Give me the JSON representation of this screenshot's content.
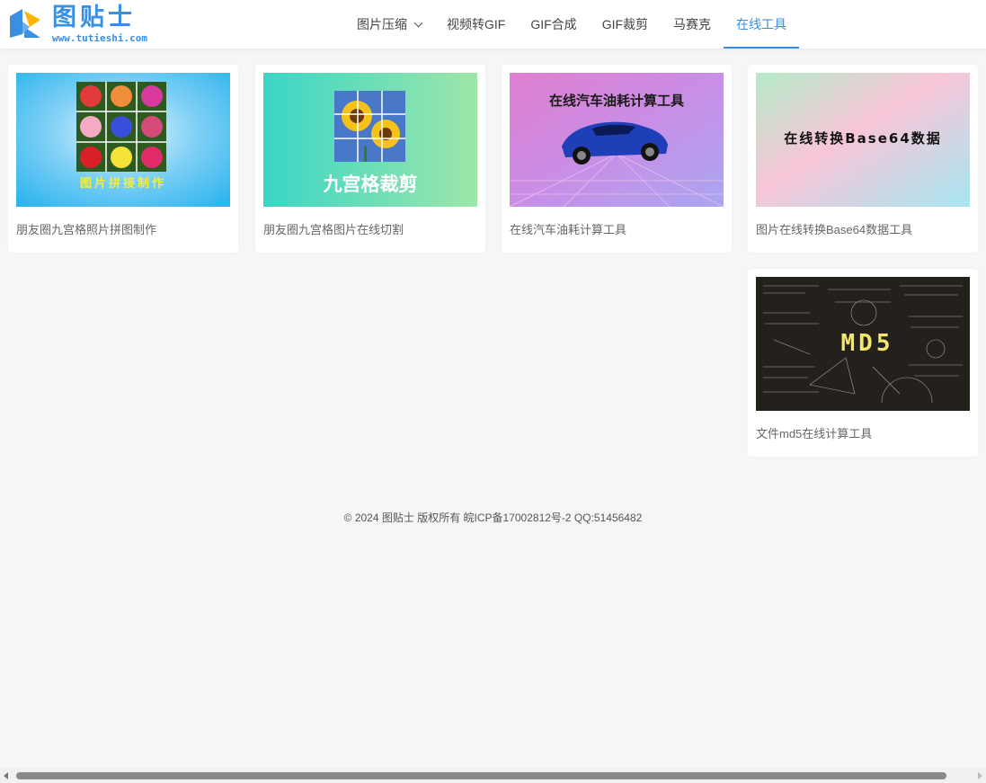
{
  "brand": {
    "name": "图贴士",
    "url_text": "www.tutieshi.com",
    "color": "#3a8fe0"
  },
  "nav": {
    "items": [
      {
        "label": "图片压缩",
        "has_dropdown": true,
        "active": false
      },
      {
        "label": "视频转GIF",
        "active": false
      },
      {
        "label": "GIF合成",
        "active": false
      },
      {
        "label": "GIF裁剪",
        "active": false
      },
      {
        "label": "马赛克",
        "active": false
      },
      {
        "label": "在线工具",
        "active": true
      }
    ]
  },
  "cards": [
    {
      "title": "朋友圈九宫格照片拼图制作",
      "thumb_text": "图片拼接制作",
      "thumb_icon": "rose-grid-image"
    },
    {
      "title": "朋友圈九宫格图片在线切割",
      "thumb_text": "九宫格裁剪",
      "thumb_icon": "sunflower-grid-image"
    },
    {
      "title": "在线汽车油耗计算工具",
      "thumb_text": "在线汽车油耗计算工具",
      "thumb_icon": "sports-car-image"
    },
    {
      "title": "图片在线转换Base64数据工具",
      "thumb_text": "在线转换Base64数据",
      "thumb_icon": "gradient-image"
    },
    {
      "title": "文件md5在线计算工具",
      "thumb_text": "MD5",
      "thumb_icon": "chalkboard-formulas-image"
    }
  ],
  "footer": {
    "text": "© 2024 图贴士 版权所有 皖ICP备17002812号-2 QQ:51456482"
  }
}
